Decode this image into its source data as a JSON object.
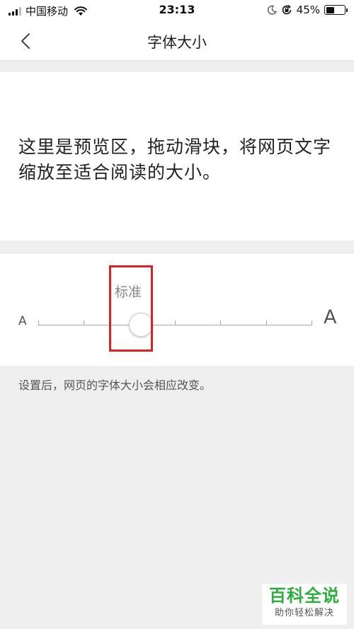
{
  "status_bar": {
    "carrier": "中国移动",
    "time": "23:13",
    "battery_text": "45%",
    "battery_level": 0.45,
    "icons": [
      "signal-icon",
      "wifi-icon",
      "moon-icon",
      "rotation-lock-icon",
      "battery-icon"
    ]
  },
  "nav": {
    "title": "字体大小",
    "back_icon": "chevron-left-icon"
  },
  "preview": {
    "text": "这里是预览区，拖动滑块，将网页文字缩放至适合阅读的大小。"
  },
  "font_slider": {
    "min_label": "A",
    "max_label": "A",
    "current_label": "标准",
    "steps": 7,
    "current_step": 2
  },
  "hint": "设置后，网页的字体大小会相应改变。",
  "watermark": {
    "title": "百科全说",
    "subtitle": "助你轻松解决"
  },
  "colors": {
    "highlight": "#e02020",
    "watermark_green": "#2eac3f"
  }
}
